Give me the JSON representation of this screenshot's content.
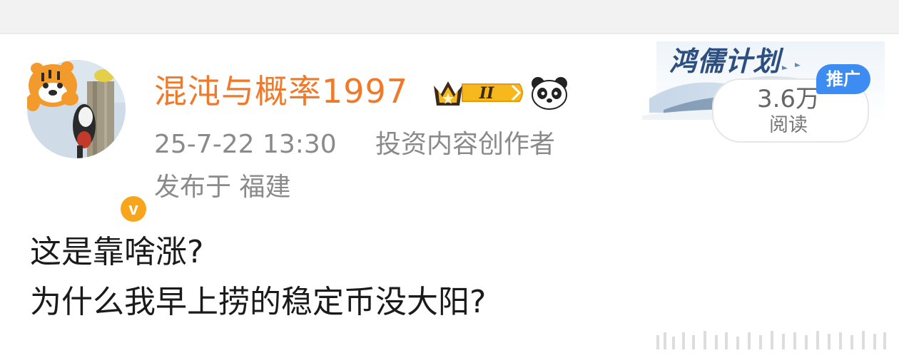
{
  "user": {
    "name": "混沌与概率1997",
    "avatar_icon": "tiger-woodpecker-avatar",
    "verified_icon": "verified-v-badge-icon",
    "vip_icon": "crown-level-badge-icon",
    "vip_level": "II",
    "emoji_icon": "panda-icon"
  },
  "meta": {
    "time": "25-7-22 13:30",
    "role": "投资内容创作者",
    "location": "发布于 福建"
  },
  "post": {
    "line1": "这是靠啥涨?",
    "line2": "为什么我早上捞的稳定币没大阳?"
  },
  "ad": {
    "campaign": "鸿儒计划",
    "badge": "推广",
    "read_count": "3.6万",
    "read_label": "阅读"
  },
  "colors": {
    "username": "#f07a2b",
    "meta": "#8a8a8a",
    "body": "#1a1a1a",
    "promo_badge": "#3d8cf2",
    "campaign": "#2d4f80"
  }
}
